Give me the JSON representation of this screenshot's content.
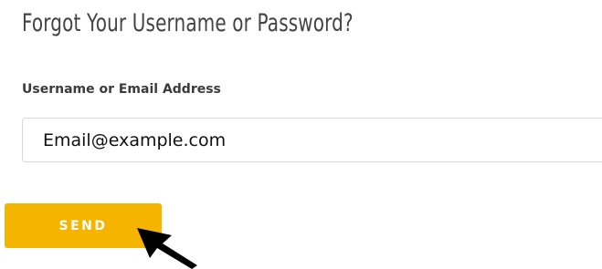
{
  "form": {
    "title": "Forgot Your Username or Password?",
    "field_label": "Username or Email Address",
    "input_value": "Email@example.com",
    "send_label": "SEND"
  },
  "colors": {
    "button_bg": "#f5b400",
    "button_text": "#ffffff",
    "title": "#444444",
    "label": "#3b3b3b",
    "input_border": "#d9d9d9"
  },
  "icons": {
    "pointer": "arrow-cursor-icon"
  }
}
